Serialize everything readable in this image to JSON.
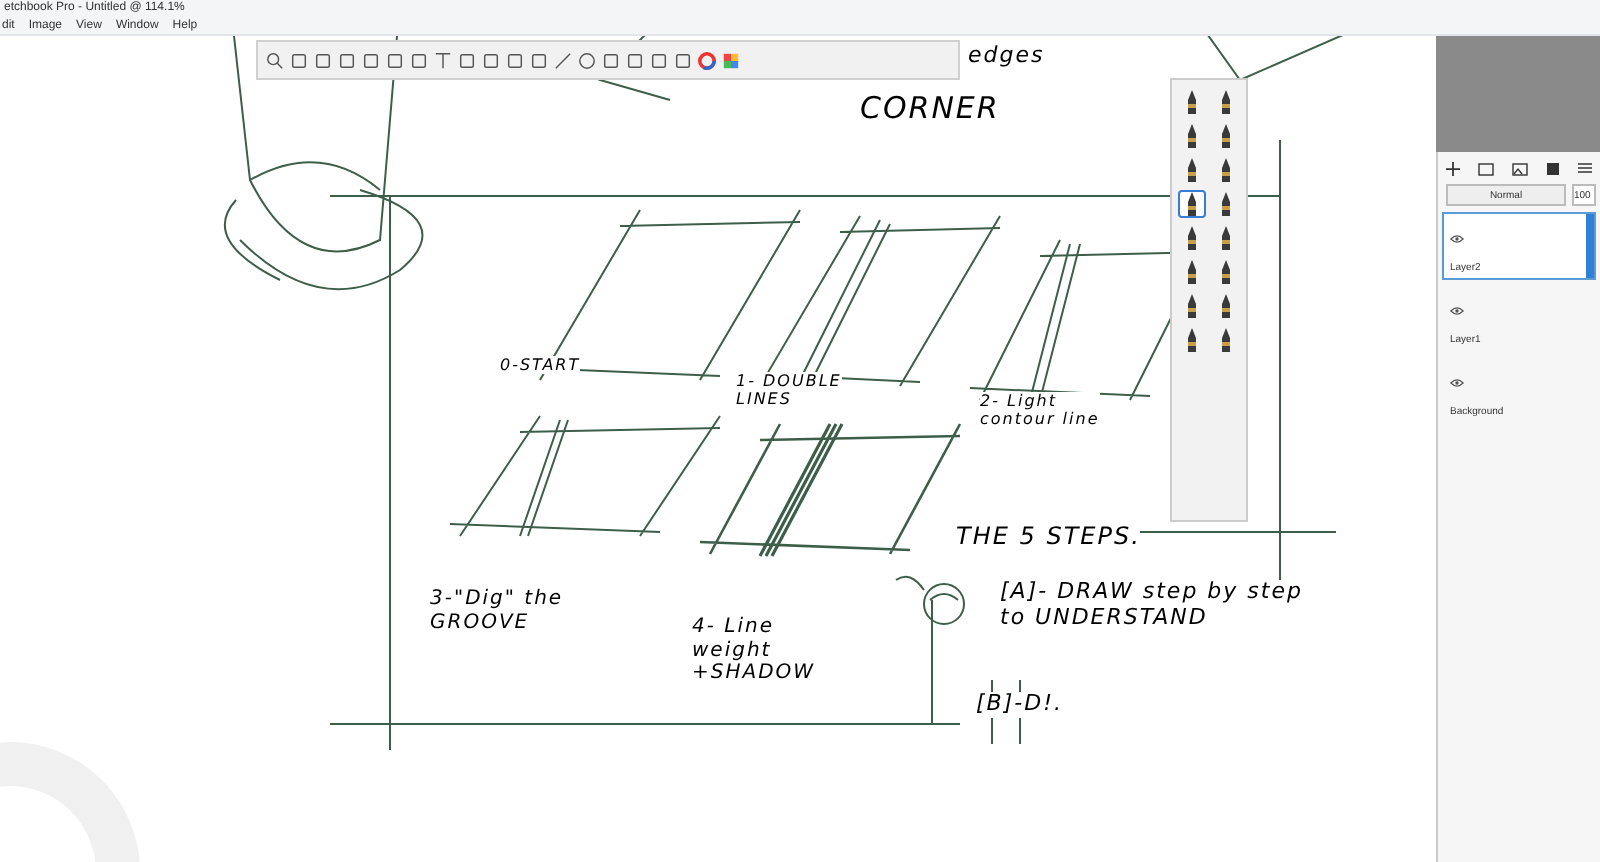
{
  "window": {
    "title": "etchbook Pro - Untitled @ 114.1%"
  },
  "menu": [
    {
      "label": "dit"
    },
    {
      "label": "Image"
    },
    {
      "label": "View"
    },
    {
      "label": "Window"
    },
    {
      "label": "Help"
    }
  ],
  "brushes": [
    {
      "selected": false
    },
    {
      "selected": false
    },
    {
      "selected": false
    },
    {
      "selected": false
    },
    {
      "selected": false
    },
    {
      "selected": false
    },
    {
      "selected": true
    },
    {
      "selected": false
    },
    {
      "selected": false
    },
    {
      "selected": false
    },
    {
      "selected": false
    },
    {
      "selected": false
    },
    {
      "selected": false
    },
    {
      "selected": false
    },
    {
      "selected": false
    },
    {
      "selected": false
    }
  ],
  "layers": {
    "blend_mode": "Normal",
    "opacity": "100",
    "items": [
      {
        "name": "Layer2",
        "selected": true,
        "visible": true
      },
      {
        "name": "Layer1",
        "selected": false,
        "visible": true
      },
      {
        "name": "Background",
        "selected": false,
        "visible": true
      }
    ]
  },
  "canvas_notes": [
    {
      "lines": [
        "edges"
      ]
    },
    {
      "lines": [
        "CORNER"
      ]
    },
    {
      "lines": [
        "0-START"
      ]
    },
    {
      "lines": [
        "1- DOUBLE",
        "LINES"
      ]
    },
    {
      "lines": [
        "2- Light",
        "contour line"
      ]
    },
    {
      "lines": [
        "3-\"Dig\" the",
        "GROOVE"
      ]
    },
    {
      "lines": [
        "4- Line",
        "weight",
        "+SHADOW"
      ]
    },
    {
      "lines": [
        "THE 5 STEPS."
      ]
    },
    {
      "lines": [
        "[A]- DRAW step by step",
        "to UNDERSTAND"
      ]
    },
    {
      "lines": [
        "[B]-D!."
      ]
    }
  ]
}
